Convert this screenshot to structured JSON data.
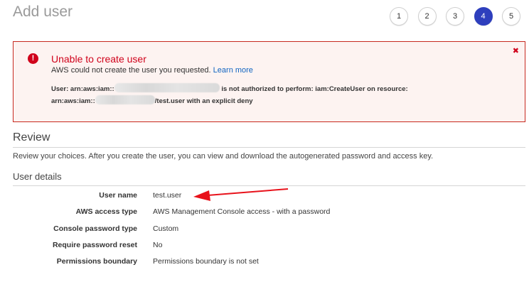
{
  "header": {
    "title": "Add user",
    "steps": [
      "1",
      "2",
      "3",
      "4",
      "5"
    ],
    "active_step": "4"
  },
  "error": {
    "title": "Unable to create user",
    "message": "AWS could not create the user you requested.",
    "link": "Learn more",
    "detail_part1": "User: arn:aws:iam::",
    "detail_part2": " is not authorized to perform: iam:CreateUser on resource:",
    "detail_part3": "arn:aws:iam::",
    "detail_part4": "/test.user with an explicit deny",
    "close": "✖"
  },
  "review": {
    "title": "Review",
    "description": "Review your choices. After you create the user, you can view and download the autogenerated password and access key.",
    "subsection_title": "User details",
    "rows": [
      {
        "label": "User name",
        "value": "test.user"
      },
      {
        "label": "AWS access type",
        "value": "AWS Management Console access - with a password"
      },
      {
        "label": "Console password type",
        "value": "Custom"
      },
      {
        "label": "Require password reset",
        "value": "No"
      },
      {
        "label": "Permissions boundary",
        "value": "Permissions boundary is not set"
      }
    ]
  },
  "colors": {
    "accent": "#2e3fbd",
    "error": "#d0021b",
    "link": "#1165c1",
    "annotation_arrow": "#e8121b"
  }
}
